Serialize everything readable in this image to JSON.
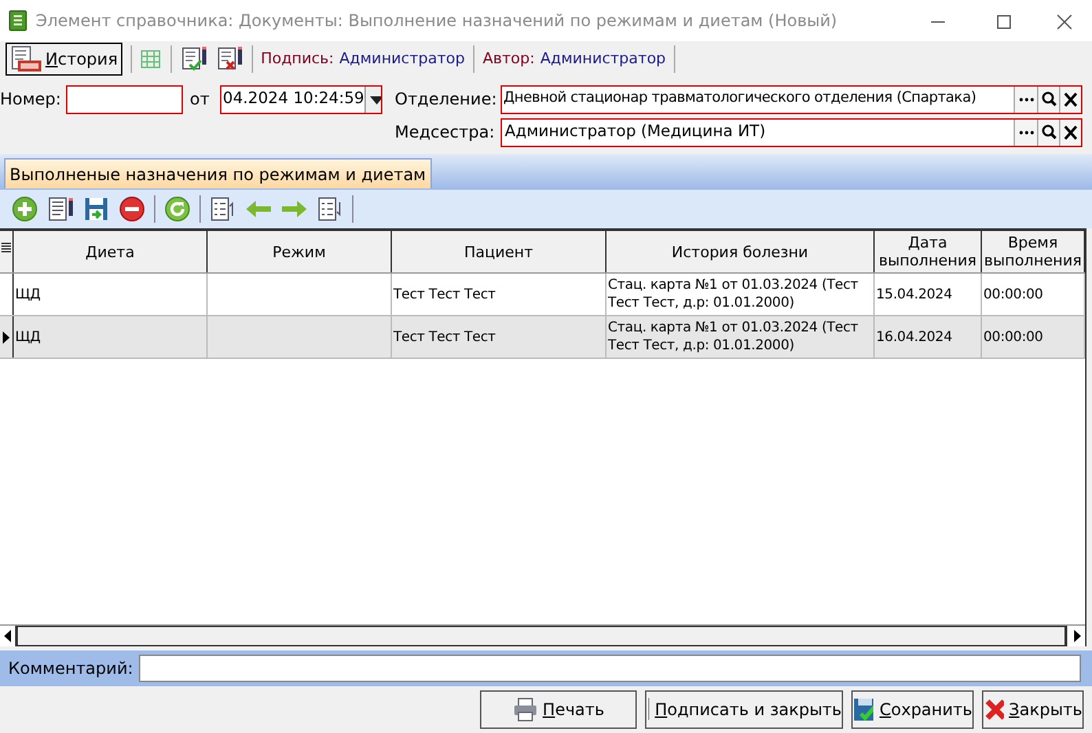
{
  "window": {
    "title": "Элемент справочника: Документы: Выполнение назначений по режимам и диетам (Новый)"
  },
  "toolbar": {
    "history_button": "История",
    "sign_label": "Подпись:",
    "sign_value": "Администратор",
    "author_label": "Автор:",
    "author_value": "Администратор"
  },
  "form": {
    "number_label": "Номер:",
    "date_label": "от",
    "date_value": "04.2024 10:24:59",
    "department_label": "Отделение:",
    "department_value": "Дневной стационар травматологического отделения (Спартака)",
    "nurse_label": "Медсестра:",
    "nurse_value": "Администратор (Медицина ИТ)"
  },
  "tabs": [
    {
      "label": "Выполненые назначения по режимам и диетам",
      "selected": true
    }
  ],
  "table": {
    "columns": [
      "Диета",
      "Режим",
      "Пациент",
      "История болезни",
      "Дата выполнения",
      "Время выполнения"
    ],
    "rows": [
      {
        "selected": false,
        "cells": [
          "ЩД",
          "",
          "Тест Тест Тест",
          "Стац. карта №1 от 01.03.2024 (Тест Тест Тест, д.р: 01.01.2000)",
          "15.04.2024",
          "00:00:00"
        ]
      },
      {
        "selected": true,
        "cells": [
          "ЩД",
          "",
          "Тест Тест Тест",
          "Стац. карта №1 от 01.03.2024 (Тест Тест Тест, д.р: 01.01.2000)",
          "16.04.2024",
          "00:00:00"
        ]
      }
    ]
  },
  "comment": {
    "label": "Комментарий:"
  },
  "buttons": [
    {
      "kind": "print",
      "label": "Печать"
    },
    {
      "kind": "sign",
      "label": "Подписать и закрыть"
    },
    {
      "kind": "save",
      "label": "Сохранить"
    },
    {
      "kind": "close",
      "label": "Закрыть"
    }
  ]
}
